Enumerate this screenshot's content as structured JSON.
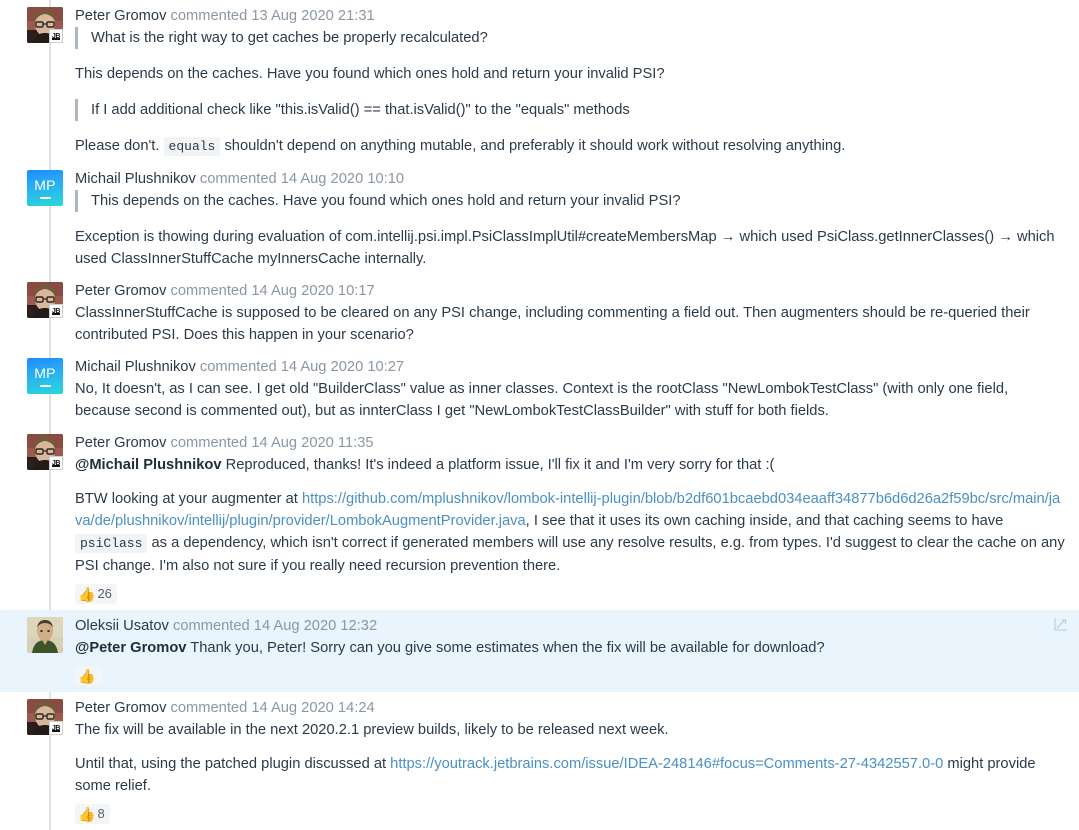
{
  "thread": {
    "comments": [
      {
        "id": "c1",
        "author": "Peter Gromov",
        "meta": "commented 13 Aug 2020 21:31",
        "avatar_type": "photo-peter",
        "highlighted": false,
        "blocks": [
          {
            "type": "quote",
            "text": "What is the right way to get caches be properly recalculated?"
          },
          {
            "type": "para",
            "text": "This depends on the caches. Have you found which ones hold and return your invalid PSI?"
          },
          {
            "type": "quote",
            "text": "If I add additional check like \"this.isValid() == that.isValid()\" to the \"equals\" methods"
          },
          {
            "type": "para-code",
            "before": "Please don't. ",
            "code": "equals",
            "after": " shouldn't depend on anything mutable, and preferably it should work without resolving anything."
          }
        ],
        "reaction": null
      },
      {
        "id": "c2",
        "author": "Michail Plushnikov",
        "meta": "commented 14 Aug 2020 10:10",
        "avatar_type": "initials-mp",
        "avatar_initials": "MP",
        "highlighted": false,
        "blocks": [
          {
            "type": "quote",
            "text": "This depends on the caches. Have you found which ones hold and return your invalid PSI?"
          },
          {
            "type": "para",
            "text": "Exception is thowing during evaluation of com.intellij.psi.impl.PsiClassImplUtil#createMembersMap → which used PsiClass.getInnerClasses() → which used ClassInnerStuffCache myInnersCache internally."
          }
        ],
        "reaction": null
      },
      {
        "id": "c3",
        "author": "Peter Gromov",
        "meta": "commented 14 Aug 2020 10:17",
        "avatar_type": "photo-peter",
        "highlighted": false,
        "blocks": [
          {
            "type": "para",
            "text": "ClassInnerStuffCache is supposed to be cleared on any PSI change, including commenting a field out. Then augmenters should be re-queried their contributed PSI. Does this happen in your scenario?"
          }
        ],
        "reaction": null
      },
      {
        "id": "c4",
        "author": "Michail Plushnikov",
        "meta": "commented 14 Aug 2020 10:27",
        "avatar_type": "initials-mp",
        "avatar_initials": "MP",
        "highlighted": false,
        "blocks": [
          {
            "type": "para",
            "text": "No, It doesn't, as I can see. I get old \"BuilderClass\" value as inner classes. Context is the rootClass \"NewLombokTestClass\" (with only one field, because second is commented out), but as innterClass I get \"NewLombokTestClassBuilder\" with stuff for both fields."
          }
        ],
        "reaction": null
      },
      {
        "id": "c5",
        "author": "Peter Gromov",
        "meta": "commented 14 Aug 2020 11:35",
        "avatar_type": "photo-peter",
        "highlighted": false,
        "blocks": [
          {
            "type": "para-mention",
            "mention": "@Michail Plushnikov",
            "text": " Reproduced, thanks! It's indeed a platform issue, I'll fix it and I'm very sorry for that :("
          },
          {
            "type": "para-link-code",
            "before": "BTW looking at your augmenter at ",
            "link": "https://github.com/mplushnikov/lombok-intellij-plugin/blob/b2df601bcaebd034eaaff34877b6d6d26a2f59bc/src/main/java/de/plushnikov/intellij/plugin/provider/LombokAugmentProvider.java",
            "mid": ", I see that it uses its own caching inside, and that caching seems to have ",
            "code": "psiClass",
            "after": " as a dependency, which isn't correct if generated members will use any resolve results, e.g. from types. I'd suggest to clear the cache on any PSI change. I'm also not sure if you really need recursion prevention there."
          }
        ],
        "reaction": {
          "emoji": "👍",
          "count": "26"
        }
      },
      {
        "id": "c6",
        "author": "Oleksii Usatov",
        "meta": "commented 14 Aug 2020 12:32",
        "avatar_type": "photo-oleksii",
        "highlighted": true,
        "expand_icon": "expand-icon",
        "blocks": [
          {
            "type": "para-mention",
            "mention": "@Peter Gromov",
            "text": " Thank you, Peter! Sorry can you give some estimates when the fix will be available for download?"
          }
        ],
        "reaction": {
          "emoji": "👍",
          "count": ""
        }
      },
      {
        "id": "c7",
        "author": "Peter Gromov",
        "meta": "commented 14 Aug 2020 14:24",
        "avatar_type": "photo-peter",
        "highlighted": false,
        "blocks": [
          {
            "type": "para",
            "text": "The fix will be available in the next 2020.2.1 preview builds, likely to be released next week."
          },
          {
            "type": "para-link",
            "before": "Until that, using the patched plugin discussed at ",
            "link": "https://youtrack.jetbrains.com/issue/IDEA-248146#focus=Comments-27-4342557.0-0",
            "after": " might provide some relief."
          }
        ],
        "reaction": {
          "emoji": "👍",
          "count": "8"
        }
      }
    ]
  },
  "colors": {
    "link": "#4a90c4",
    "meta_text": "#8a97a5",
    "body_text": "#2b3a4a",
    "highlight_bg": "#eaf4fd",
    "rail": "#dfe1e5",
    "quote_bar": "#aeb6be",
    "code_bg": "#f2f3f5",
    "reaction_bg": "#f4f5f7"
  }
}
